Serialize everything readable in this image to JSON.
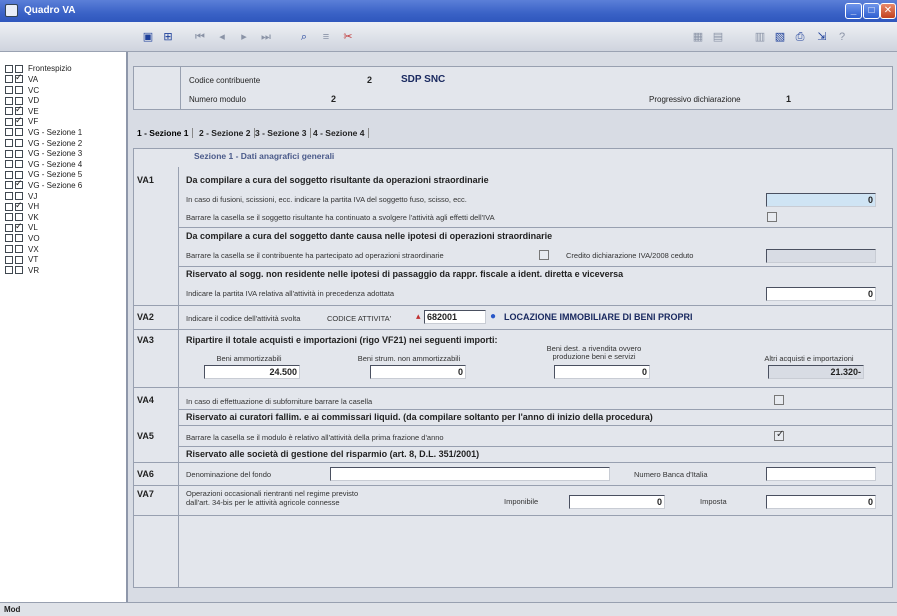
{
  "window": {
    "title": "Quadro VA"
  },
  "sidebar": {
    "items": [
      {
        "label": "Frontespizio",
        "checked": false
      },
      {
        "label": "VA",
        "checked": true
      },
      {
        "label": "VC",
        "checked": false
      },
      {
        "label": "VD",
        "checked": false
      },
      {
        "label": "VE",
        "checked": true
      },
      {
        "label": "VF",
        "checked": true
      },
      {
        "label": "VG - Sezione 1",
        "checked": false
      },
      {
        "label": "VG - Sezione 2",
        "checked": false
      },
      {
        "label": "VG - Sezione 3",
        "checked": false
      },
      {
        "label": "VG - Sezione 4",
        "checked": false
      },
      {
        "label": "VG - Sezione 5",
        "checked": false
      },
      {
        "label": "VG - Sezione 6",
        "checked": true
      },
      {
        "label": "VJ",
        "checked": false
      },
      {
        "label": "VH",
        "checked": true
      },
      {
        "label": "VK",
        "checked": false
      },
      {
        "label": "VL",
        "checked": true
      },
      {
        "label": "VO",
        "checked": false
      },
      {
        "label": "VX",
        "checked": false
      },
      {
        "label": "VT",
        "checked": false
      },
      {
        "label": "VR",
        "checked": false
      }
    ]
  },
  "header": {
    "codice_label": "Codice contribuente",
    "codice_value": "2",
    "company_name": "SDP SNC",
    "modulo_label": "Numero modulo",
    "modulo_value": "2",
    "progressivo_label": "Progressivo dichiarazione",
    "progressivo_value": "1"
  },
  "tabs": [
    {
      "label": "1 - Sezione 1"
    },
    {
      "label": "2 - Sezione 2"
    },
    {
      "label": "3 - Sezione 3"
    },
    {
      "label": "4 - Sezione 4"
    }
  ],
  "section": {
    "title": "Sezione 1 - Dati anagrafici generali",
    "va1": {
      "code": "VA1",
      "heading": "Da compilare a cura del soggetto risultante da operazioni straordinarie",
      "line1": "In caso di fusioni, scissioni, ecc. indicare la partita IVA del soggetto fuso, scisso, ecc.",
      "line1_value": "0",
      "line2": "Barrare la casella se il soggetto risultante ha continuato a svolgere l'attività agli effetti dell'IVA"
    },
    "dante": {
      "heading": "Da compilare a cura del soggetto dante causa nelle ipotesi di operazioni straordinarie",
      "line": "Barrare la casella se il contribuente ha partecipato ad operazioni straordinarie",
      "credito_label": "Credito dichiarazione IVA/2008 ceduto"
    },
    "non_residente": {
      "heading": "Riservato al sogg. non residente nelle ipotesi di passaggio da rappr. fiscale a ident. diretta e viceversa",
      "line": "Indicare la partita IVA relativa all'attività in precedenza adottata",
      "value": "0"
    },
    "va2": {
      "code": "VA2",
      "line": "Indicare il codice dell'attività svolta",
      "codice_label": "CODICE ATTIVITA'",
      "codice_value": "682001",
      "description": "LOCAZIONE IMMOBILIARE DI BENI PROPRI"
    },
    "va3": {
      "code": "VA3",
      "heading": "Ripartire il totale acquisti e importazioni (rigo VF21) nei seguenti importi:",
      "beni_amm_label": "Beni ammortizzabili",
      "beni_amm_value": "24.500",
      "beni_strum_label": "Beni strum. non ammortizzabili",
      "beni_strum_value": "0",
      "beni_dest_label": "Beni dest. a rivendita ovvero produzione beni e servizi",
      "beni_dest_value": "0",
      "altri_label": "Altri acquisti e importazioni",
      "altri_value": "21.320-"
    },
    "va4": {
      "code": "VA4",
      "line": "In caso di effettuazione di subforniture barrare la casella"
    },
    "curatori": {
      "heading": "Riservato ai curatori fallim. e ai commissari liquid. (da compilare soltanto per l'anno di inizio della procedura)"
    },
    "va5": {
      "code": "VA5",
      "line": "Barrare la casella se il modulo è relativo all'attività della prima frazione d'anno"
    },
    "risparmio": {
      "heading": "Riservato alle società di gestione del risparmio (art. 8, D.L. 351/2001)"
    },
    "va6": {
      "code": "VA6",
      "line": "Denominazione del fondo",
      "banca_label": "Numero Banca d'Italia"
    },
    "va7": {
      "code": "VA7",
      "line1": "Operazioni occasionali rientranti nel regime previsto",
      "line2": "dall'art. 34-bis per le attività agricole connesse",
      "imponibile_label": "Imponibile",
      "imponibile_value": "0",
      "imposta_label": "Imposta",
      "imposta_value": "0"
    }
  },
  "status": {
    "mod": "Mod"
  },
  "colors": {
    "titlebar": "#3a62c6",
    "accent": "#1d3f9a",
    "panel": "#e3e6ec"
  }
}
